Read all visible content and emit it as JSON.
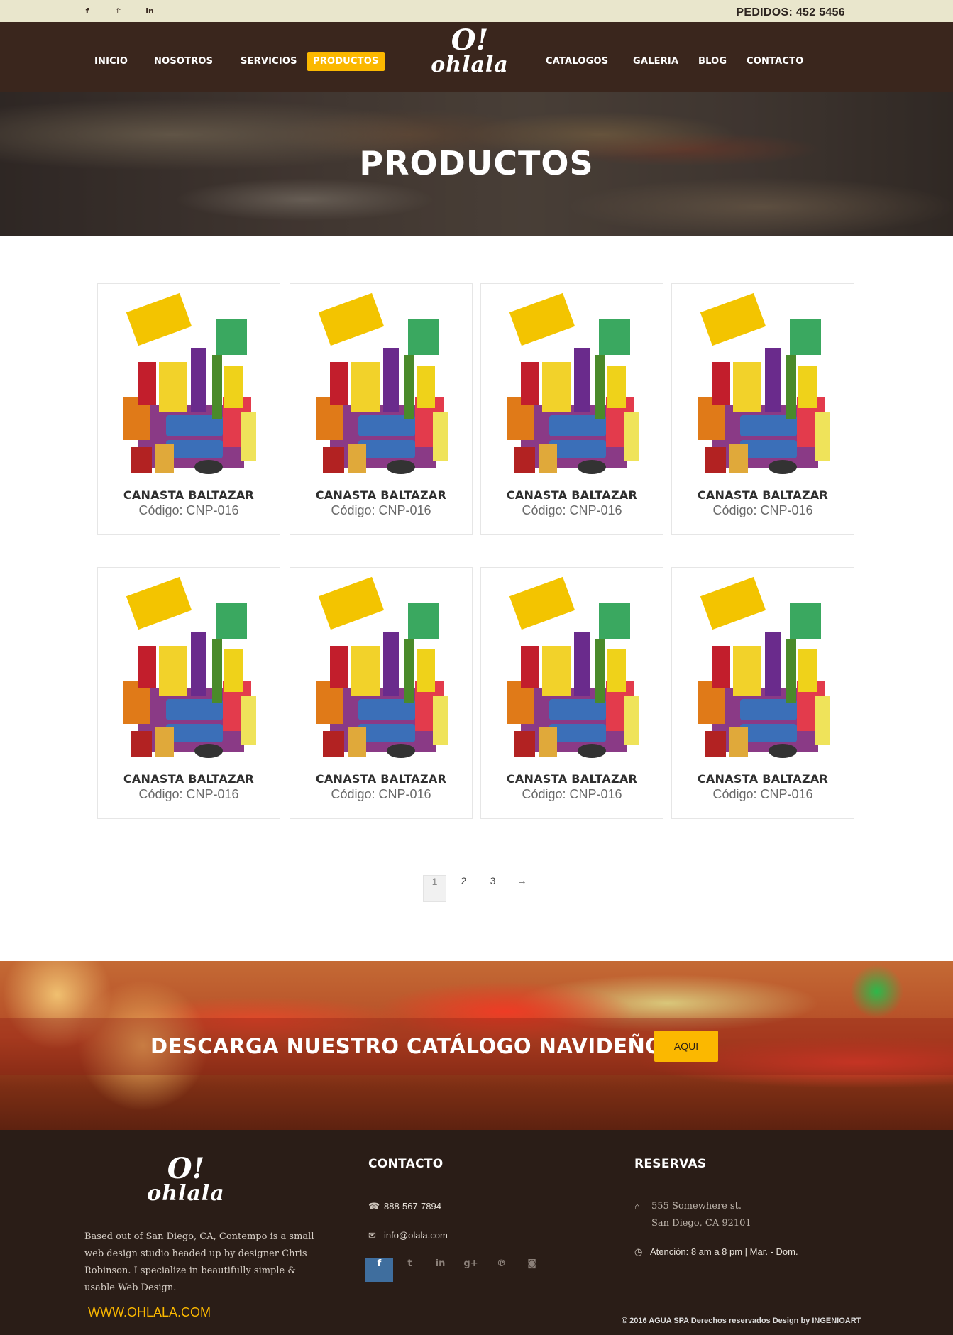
{
  "topbar": {
    "social_icons": [
      "facebook-icon",
      "twitter-icon",
      "linkedin-icon"
    ],
    "phone_label": "PEDIDOS:  452 5456"
  },
  "nav": {
    "items": [
      "INICIO",
      "NOSOTROS",
      "SERVICIOS",
      "PRODUCTOS",
      "CATALOGOS",
      "GALERIA",
      "BLOG",
      "CONTACTO"
    ],
    "active": "PRODUCTOS"
  },
  "logo": {
    "mark": "O!",
    "word": "ohlala"
  },
  "hero": {
    "title": "PRODUCTOS"
  },
  "products": [
    {
      "name": "CANASTA BALTAZAR",
      "code": "Código: CNP-016"
    },
    {
      "name": "CANASTA BALTAZAR",
      "code": "Código: CNP-016"
    },
    {
      "name": "CANASTA BALTAZAR",
      "code": "Código: CNP-016"
    },
    {
      "name": "CANASTA BALTAZAR",
      "code": "Código: CNP-016"
    },
    {
      "name": "CANASTA BALTAZAR",
      "code": "Código: CNP-016"
    },
    {
      "name": "CANASTA BALTAZAR",
      "code": "Código: CNP-016"
    },
    {
      "name": "CANASTA BALTAZAR",
      "code": "Código: CNP-016"
    },
    {
      "name": "CANASTA BALTAZAR",
      "code": "Código: CNP-016"
    }
  ],
  "pagination": {
    "pages": [
      "1",
      "2",
      "3"
    ],
    "current": "1",
    "next": "→"
  },
  "banner": {
    "title": "DESCARGA NUESTRO CATÁLOGO NAVIDEÑO",
    "button": "AQUI"
  },
  "footer": {
    "about": "Based out of San Diego, CA, Contempo is a small web design studio headed up by designer Chris Robinson. I specialize in beautifully simple & usable Web Design.",
    "website": "WWW.OHLALA.COM",
    "contact_title": "CONTACTO",
    "phone": "888-567-7894",
    "email": "info@olala.com",
    "social": [
      "facebook-icon",
      "twitter-icon",
      "linkedin-icon",
      "google-plus-icon",
      "pinterest-icon",
      "instagram-icon"
    ],
    "reservas_title": "RESERVAS",
    "address_line1": "555 Somewhere st.",
    "address_line2": "San Diego, CA 92101",
    "hours": "Atención: 8 am a 8 pm  |  Mar. - Dom.",
    "copyright": "© 2016   AGUA SPA   Derechos reservados Design by INGENIOART"
  },
  "colors": {
    "accent": "#fbb800",
    "nav_bg": "#3a261d",
    "topbar_bg": "#e9e6cc",
    "footer_bg": "#2a1d17"
  }
}
